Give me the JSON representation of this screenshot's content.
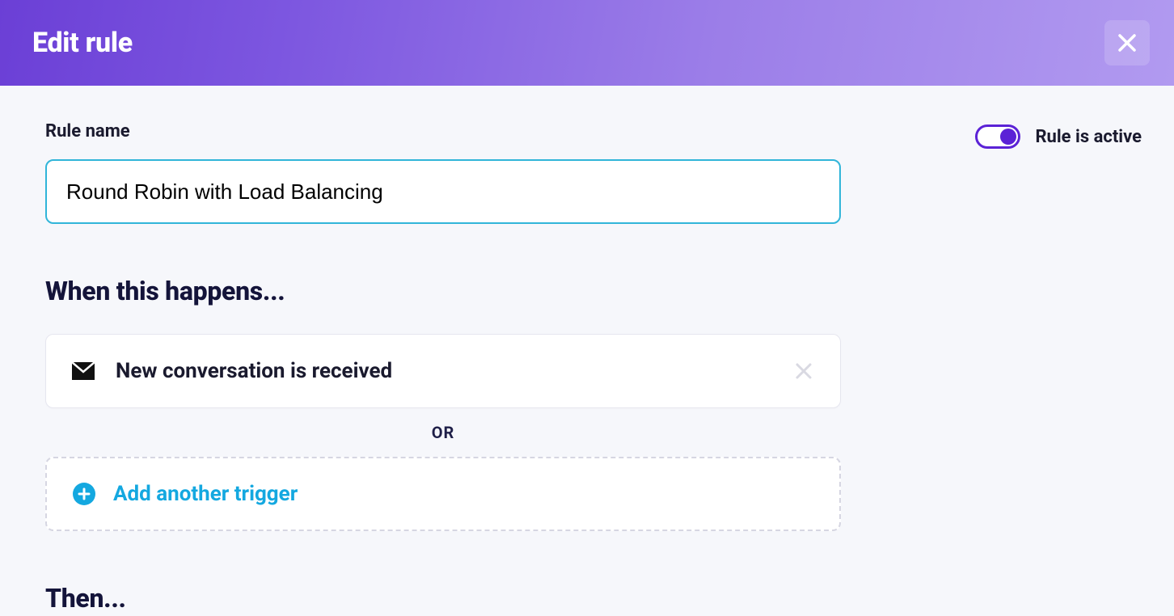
{
  "header": {
    "title": "Edit rule"
  },
  "form": {
    "rule_name_label": "Rule name",
    "rule_name_value": "Round Robin with Load Balancing",
    "toggle_label": "Rule is active",
    "toggle_on": true
  },
  "sections": {
    "when_heading": "When this happens...",
    "then_heading": "Then..."
  },
  "triggers": [
    {
      "icon": "mail-icon",
      "label": "New conversation is received"
    }
  ],
  "separator_text": "OR",
  "add_trigger_label": "Add another trigger"
}
